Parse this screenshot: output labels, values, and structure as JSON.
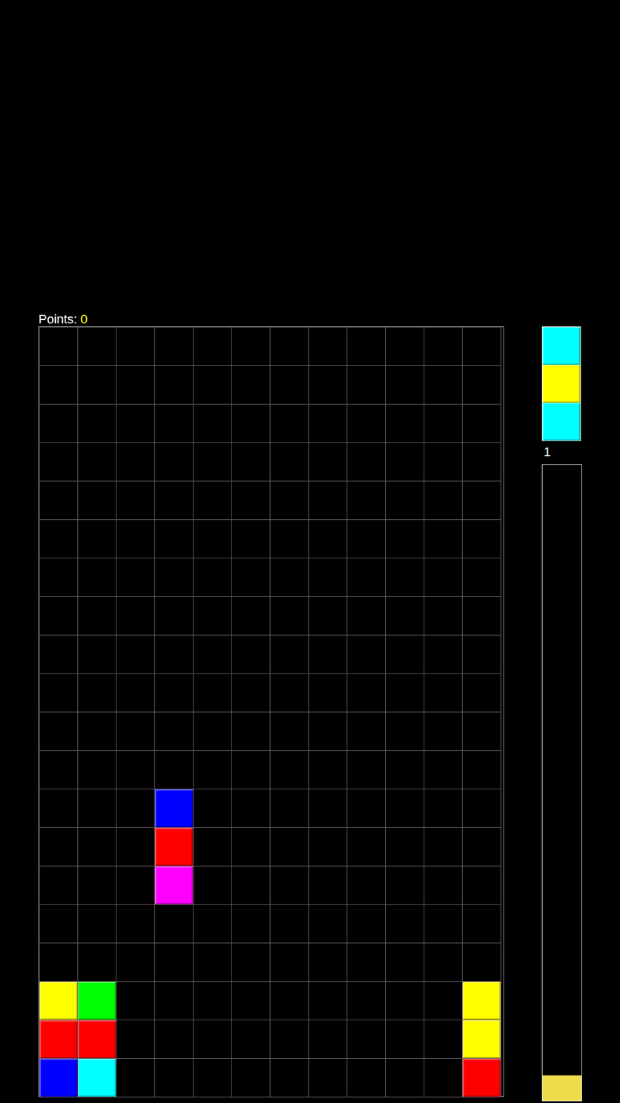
{
  "score": {
    "label": "Points:",
    "value": "0"
  },
  "board": {
    "rows": [
      [
        null,
        null,
        null,
        null,
        null,
        null,
        null,
        null,
        null,
        null,
        null,
        null
      ],
      [
        null,
        null,
        null,
        null,
        null,
        null,
        null,
        null,
        null,
        null,
        null,
        null
      ],
      [
        null,
        null,
        null,
        null,
        null,
        null,
        null,
        null,
        null,
        null,
        null,
        null
      ],
      [
        null,
        null,
        null,
        null,
        null,
        null,
        null,
        null,
        null,
        null,
        null,
        null
      ],
      [
        null,
        null,
        null,
        null,
        null,
        null,
        null,
        null,
        null,
        null,
        null,
        null
      ],
      [
        null,
        null,
        null,
        null,
        null,
        null,
        null,
        null,
        null,
        null,
        null,
        null
      ],
      [
        null,
        null,
        null,
        null,
        null,
        null,
        null,
        null,
        null,
        null,
        null,
        null
      ],
      [
        null,
        null,
        null,
        null,
        null,
        null,
        null,
        null,
        null,
        null,
        null,
        null
      ],
      [
        null,
        null,
        null,
        null,
        null,
        null,
        null,
        null,
        null,
        null,
        null,
        null
      ],
      [
        null,
        null,
        null,
        null,
        null,
        null,
        null,
        null,
        null,
        null,
        null,
        null
      ],
      [
        null,
        null,
        null,
        null,
        null,
        null,
        null,
        null,
        null,
        null,
        null,
        null
      ],
      [
        null,
        null,
        null,
        null,
        null,
        null,
        null,
        null,
        null,
        null,
        null,
        null
      ],
      [
        null,
        null,
        null,
        "#0000ff",
        null,
        null,
        null,
        null,
        null,
        null,
        null,
        null
      ],
      [
        null,
        null,
        null,
        "#ff0000",
        null,
        null,
        null,
        null,
        null,
        null,
        null,
        null
      ],
      [
        null,
        null,
        null,
        "#ff00ff",
        null,
        null,
        null,
        null,
        null,
        null,
        null,
        null
      ],
      [
        null,
        null,
        null,
        null,
        null,
        null,
        null,
        null,
        null,
        null,
        null,
        null
      ],
      [
        null,
        null,
        null,
        null,
        null,
        null,
        null,
        null,
        null,
        null,
        null,
        null
      ],
      [
        "#ffff00",
        "#00ff00",
        null,
        null,
        null,
        null,
        null,
        null,
        null,
        null,
        null,
        "#ffff00"
      ],
      [
        "#ff0000",
        "#ff0000",
        null,
        null,
        null,
        null,
        null,
        null,
        null,
        null,
        null,
        "#ffff00"
      ],
      [
        "#0000ff",
        "#00ffff",
        null,
        null,
        null,
        null,
        null,
        null,
        null,
        null,
        null,
        "#ff0000"
      ]
    ]
  },
  "next_piece": {
    "colors": [
      "#00ffff",
      "#ffff00",
      "#00ffff"
    ]
  },
  "level_meter": {
    "label": "1",
    "level": 0.04
  }
}
